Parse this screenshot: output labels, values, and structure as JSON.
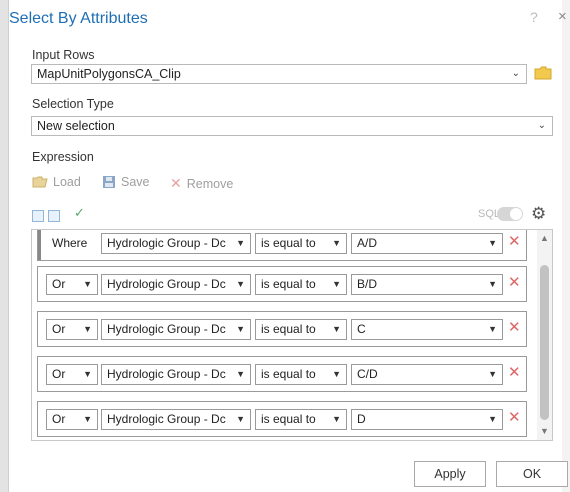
{
  "dialog": {
    "title": "Select By Attributes",
    "help": "?",
    "close": "×"
  },
  "input_rows": {
    "label": "Input Rows",
    "value": "MapUnitPolygonsCA_Clip"
  },
  "selection_type": {
    "label": "Selection Type",
    "value": "New selection"
  },
  "expression": {
    "label": "Expression",
    "toolbar": {
      "load": "Load",
      "save": "Save",
      "remove": "Remove"
    },
    "sql_label": "SQL",
    "clauses": [
      {
        "connector": "Where",
        "field": "Hydrologic Group - Dc",
        "operator": "is equal to",
        "value": "A/D"
      },
      {
        "connector": "Or",
        "field": "Hydrologic Group - Dc",
        "operator": "is equal to",
        "value": "B/D"
      },
      {
        "connector": "Or",
        "field": "Hydrologic Group - Dc",
        "operator": "is equal to",
        "value": "C"
      },
      {
        "connector": "Or",
        "field": "Hydrologic Group - Dc",
        "operator": "is equal to",
        "value": "C/D"
      },
      {
        "connector": "Or",
        "field": "Hydrologic Group - Dc",
        "operator": "is equal to",
        "value": "D"
      }
    ]
  },
  "buttons": {
    "apply": "Apply",
    "ok": "OK"
  },
  "colors": {
    "title": "#1f6fb5",
    "remove": "#e06666",
    "check": "#56a86e"
  }
}
